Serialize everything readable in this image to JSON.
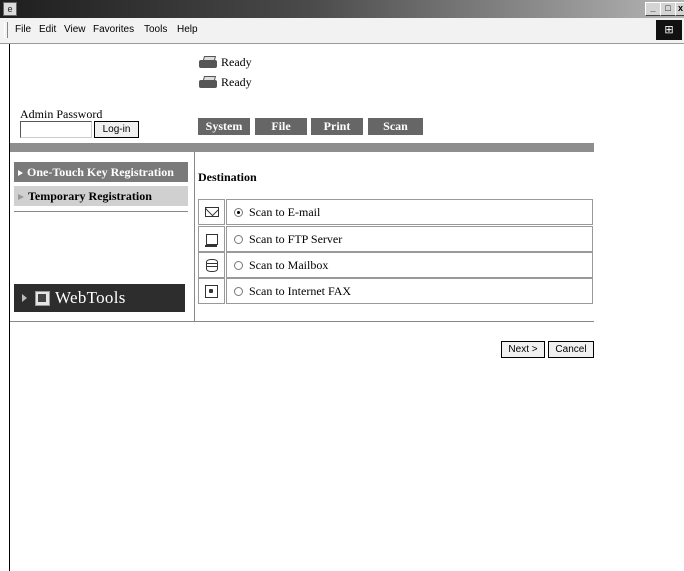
{
  "window": {
    "buttons": {
      "minimize": "_",
      "maximize": "□",
      "close": "x"
    },
    "icon": "ie-icon"
  },
  "menubar": {
    "items": [
      "File",
      "Edit",
      "View",
      "Favorites",
      "Tools",
      "Help"
    ]
  },
  "status": {
    "printer": "Ready",
    "scanner": "Ready"
  },
  "login": {
    "label": "Admin Password",
    "password_value": "",
    "button": "Log-in"
  },
  "tabs": [
    "System",
    "File",
    "Print",
    "Scan"
  ],
  "sidebar": {
    "items": [
      {
        "label": "One-Touch Key Registration",
        "active": true
      },
      {
        "label": "Temporary Registration",
        "active": false
      }
    ],
    "banner": "WebTools"
  },
  "destination": {
    "title": "Destination",
    "options": [
      {
        "label": "Scan to E-mail",
        "icon": "envelope-icon",
        "selected": true
      },
      {
        "label": "Scan to FTP Server",
        "icon": "computer-icon",
        "selected": false
      },
      {
        "label": "Scan to Mailbox",
        "icon": "database-icon",
        "selected": false
      },
      {
        "label": "Scan to Internet FAX",
        "icon": "fax-icon",
        "selected": false
      }
    ]
  },
  "actions": {
    "next": "Next >",
    "cancel": "Cancel"
  },
  "colors": {
    "tab_bg": "#666666",
    "band": "#8e8e8e",
    "nav_active": "#7a7a7a",
    "nav_inactive": "#d0d0d0",
    "banner_bg": "#2d2d2d"
  }
}
